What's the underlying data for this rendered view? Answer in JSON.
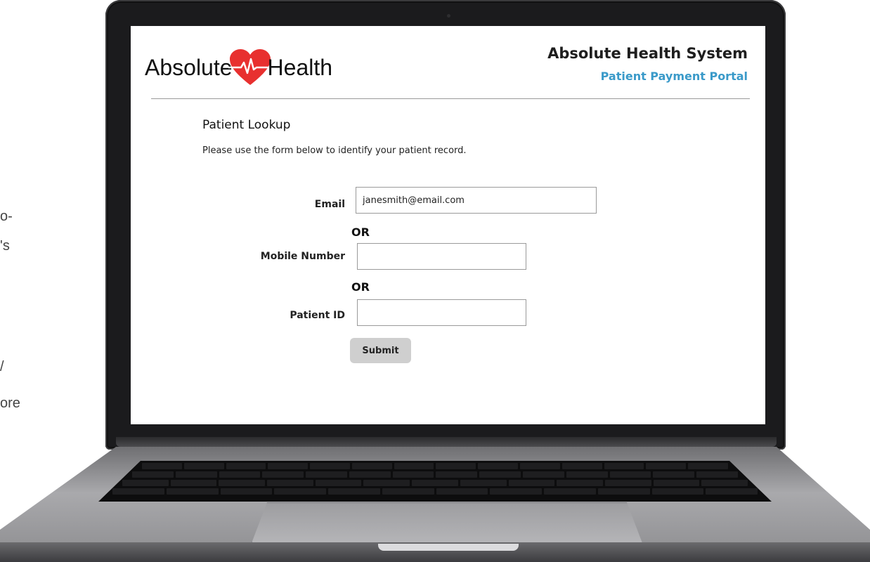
{
  "background_text": {
    "line1": "o-",
    "line2": "'s",
    "line3": "/",
    "line4": "ore"
  },
  "brand": {
    "logo_left": "Absolute",
    "logo_right": "Health",
    "heart_color": "#e8302f"
  },
  "header": {
    "title": "Absolute Health System",
    "subtitle": "Patient Payment Portal",
    "subtitle_color": "#3a9ac9"
  },
  "lookup": {
    "title": "Patient Lookup",
    "description": "Please use the form below to identify your patient record.",
    "email_label": "Email",
    "email_value": "janesmith@email.com",
    "or_1": "OR",
    "mobile_label": "Mobile Number",
    "mobile_value": "",
    "or_2": "OR",
    "patient_id_label": "Patient ID",
    "patient_id_value": "",
    "submit_label": "Submit"
  }
}
